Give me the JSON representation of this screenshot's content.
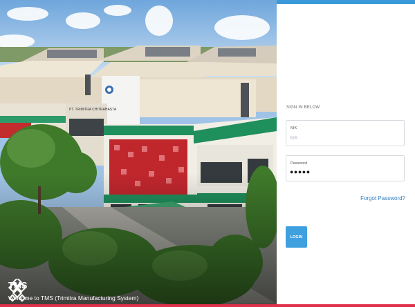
{
  "hero": {
    "building_sign": "PT. TRIMITRA CHITRAHASTA",
    "brand": {
      "logo_icon": "tms-diamond-logo-icon",
      "name": "TMS",
      "welcome": "Welcome to TMS (Trimitra Manufacturing System)"
    }
  },
  "login": {
    "heading": "SIGN IN BELOW",
    "nik": {
      "label": "NIK",
      "placeholder": "NIK",
      "value": ""
    },
    "password": {
      "label": "Password",
      "value": "●●●●●"
    },
    "forgot_label": "Forgot Password?",
    "submit_label": "LOGIN"
  },
  "colors": {
    "accent_top": "#3a9ad9",
    "accent_bottom": "#e0304b",
    "button": "#3fa0e0",
    "link": "#2f7fc1"
  }
}
